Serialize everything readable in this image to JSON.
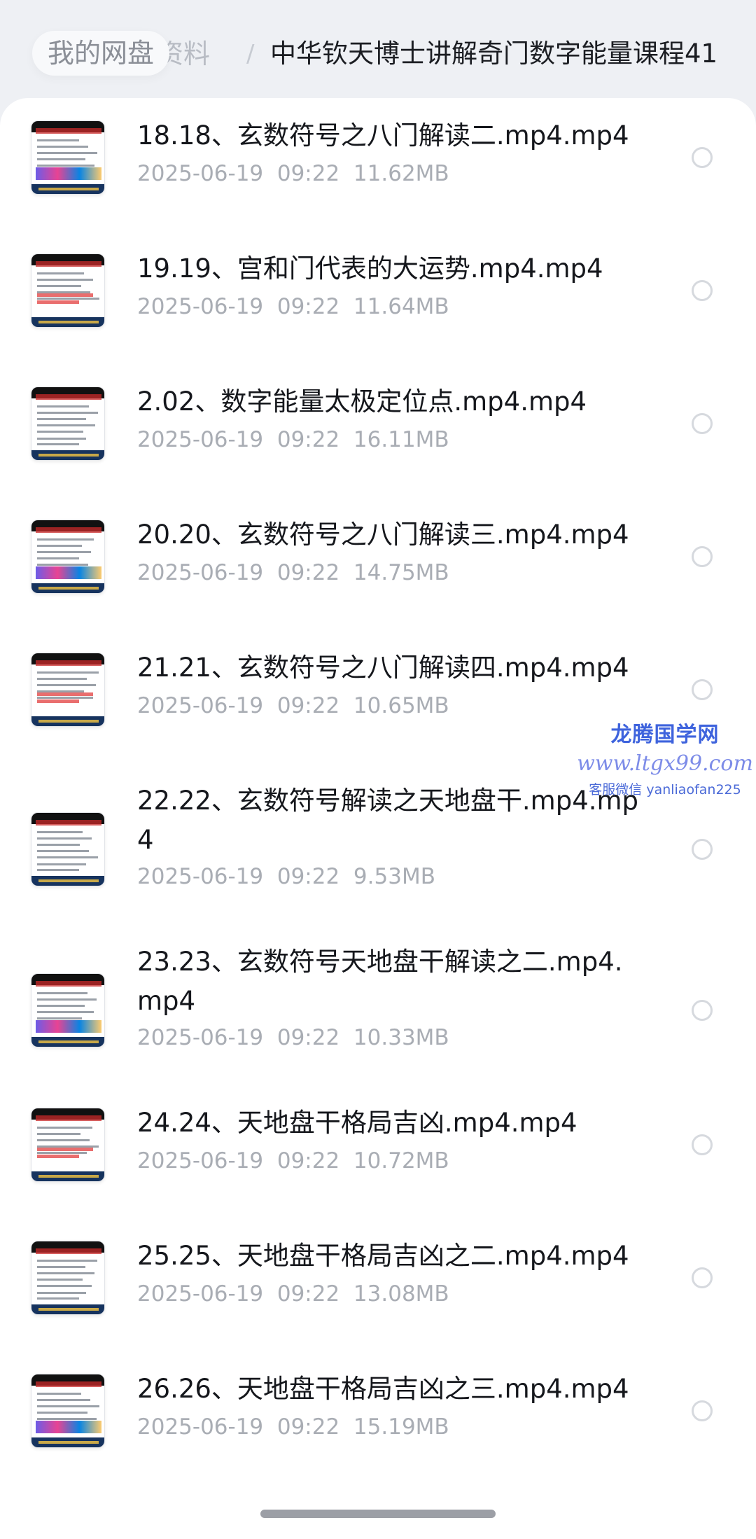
{
  "breadcrumb": {
    "root": "我的网盘",
    "middle": "资料",
    "separator": "/",
    "current": "中华钦天博士讲解奇门数字能量课程41"
  },
  "files": [
    {
      "name": "18.18、玄数符号之八门解读二.mp4.mp4",
      "date": "2025-06-19  09:22",
      "size": "11.62MB"
    },
    {
      "name": "19.19、宫和门代表的大运势.mp4.mp4",
      "date": "2025-06-19  09:22",
      "size": "11.64MB"
    },
    {
      "name": "2.02、数字能量太极定位点.mp4.mp4",
      "date": "2025-06-19  09:22",
      "size": "16.11MB"
    },
    {
      "name": "20.20、玄数符号之八门解读三.mp4.mp4",
      "date": "2025-06-19  09:22",
      "size": "14.75MB"
    },
    {
      "name": "21.21、玄数符号之八门解读四.mp4.mp4",
      "date": "2025-06-19  09:22",
      "size": "10.65MB"
    },
    {
      "name": "22.22、玄数符号解读之天地盘干.mp4.mp4",
      "date": "2025-06-19  09:22",
      "size": "9.53MB"
    },
    {
      "name": "23.23、玄数符号天地盘干解读之二.mp4.mp4",
      "date": "2025-06-19  09:22",
      "size": "10.33MB"
    },
    {
      "name": "24.24、天地盘干格局吉凶.mp4.mp4",
      "date": "2025-06-19  09:22",
      "size": "10.72MB"
    },
    {
      "name": "25.25、天地盘干格局吉凶之二.mp4.mp4",
      "date": "2025-06-19  09:22",
      "size": "13.08MB"
    },
    {
      "name": "26.26、天地盘干格局吉凶之三.mp4.mp4",
      "date": "2025-06-19  09:22",
      "size": "15.19MB"
    }
  ],
  "watermark": {
    "title": "龙腾国学网",
    "url": "www.ltgx99.com",
    "contact": "客服微信 yanliaofan225"
  },
  "colors": {
    "background": "#eef0f4",
    "card": "#ffffff",
    "title_text": "#15171c",
    "meta_text": "#a9adb4",
    "watermark_blue": "#3e63dd"
  }
}
